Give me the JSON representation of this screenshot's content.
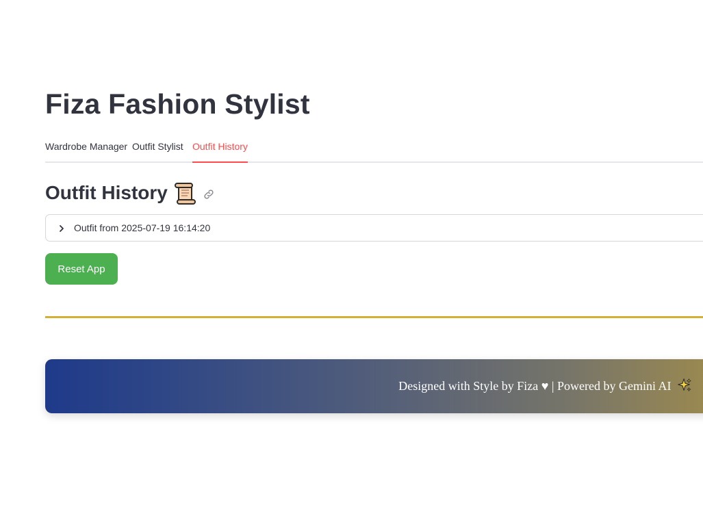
{
  "app": {
    "title": "Fiza Fashion Stylist"
  },
  "tabs": [
    {
      "label": "Wardrobe Manager",
      "active": false
    },
    {
      "label": "Outfit Stylist",
      "active": false
    },
    {
      "label": "Outfit History",
      "active": true
    }
  ],
  "section": {
    "heading": "Outfit History",
    "heading_icon": "scroll-icon",
    "anchor_icon": "link-icon"
  },
  "history": {
    "items": [
      {
        "label": "Outfit from 2025-07-19 16:14:20",
        "expanded": false,
        "icon": "chevron-right-icon"
      }
    ]
  },
  "actions": {
    "reset_label": "Reset App"
  },
  "footer": {
    "text": "Designed with Style by Fiza ♥ | Powered by Gemini AI",
    "icon": "sparkle-icon"
  },
  "colors": {
    "active_tab": "#ff4b4b",
    "reset_button": "#4caf50",
    "divider": "#d4af37",
    "footer_gradient_start": "#1f3a8a",
    "footer_gradient_end": "#9c8a4e",
    "text": "#31333f"
  }
}
